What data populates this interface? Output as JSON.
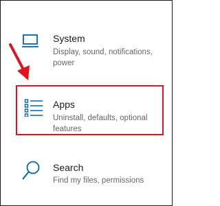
{
  "settings": {
    "items": [
      {
        "title": "System",
        "description": "Display, sound, notifications, power",
        "icon": "laptop-icon"
      },
      {
        "title": "Apps",
        "description": "Uninstall, defaults, optional features",
        "icon": "apps-list-icon",
        "highlighted": true
      },
      {
        "title": "Search",
        "description": "Find my files, permissions",
        "icon": "search-icon"
      }
    ]
  },
  "colors": {
    "accent_icon": "#0063b1",
    "highlight_box": "#e3131c",
    "annotation_arrow": "#e3131c",
    "title_text": "#1a1a1a",
    "description_text": "#666666"
  }
}
